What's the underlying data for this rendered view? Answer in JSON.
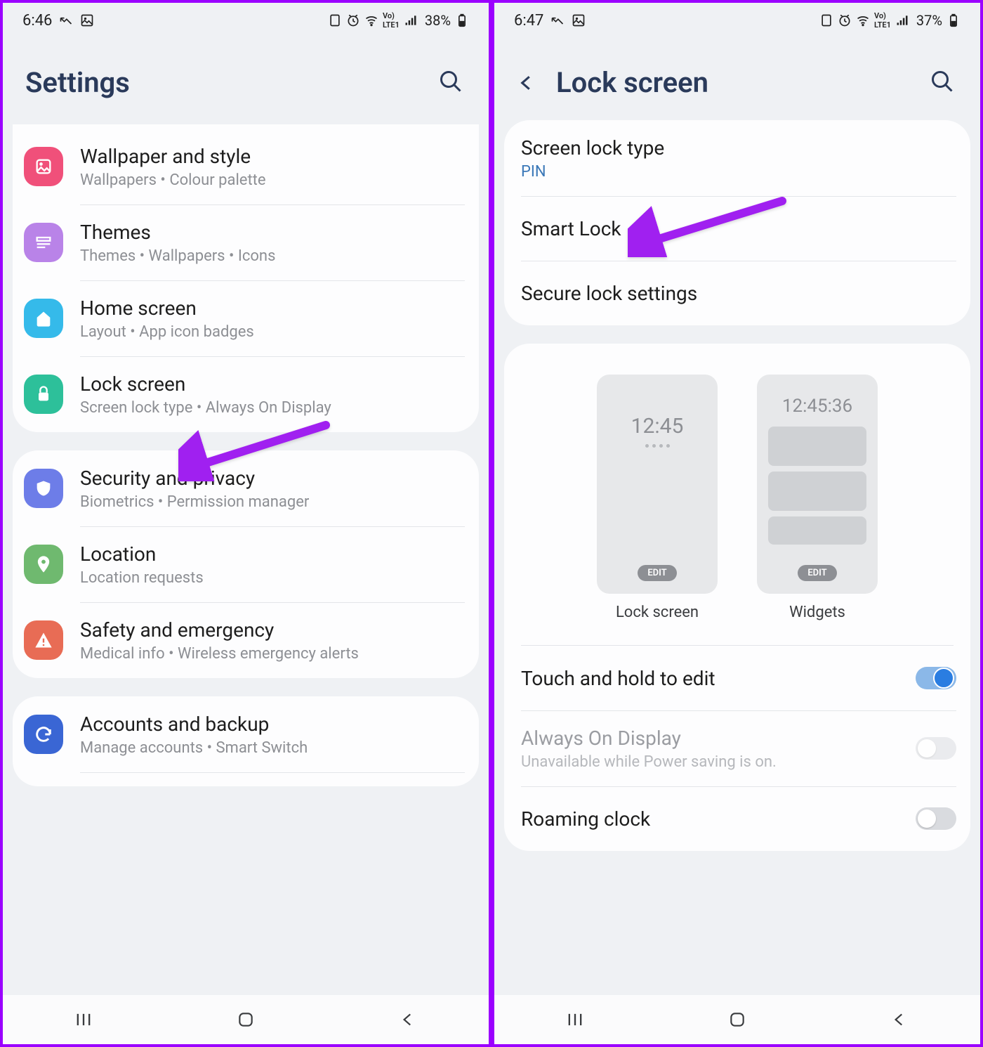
{
  "left": {
    "status": {
      "time": "6:46",
      "battery": "38%"
    },
    "header": {
      "title": "Settings"
    },
    "groups": [
      {
        "rows": [
          {
            "icon": "wallpaper",
            "color": "#f0507a",
            "title": "Wallpaper and style",
            "sub": "Wallpapers   •   Colour palette"
          },
          {
            "icon": "themes",
            "color": "#b983e8",
            "title": "Themes",
            "sub": "Themes   •   Wallpapers   •   Icons"
          },
          {
            "icon": "home",
            "color": "#35baea",
            "title": "Home screen",
            "sub": "Layout   •   App icon badges"
          },
          {
            "icon": "lock",
            "color": "#2dc09a",
            "title": "Lock screen",
            "sub": "Screen lock type   •   Always On Display"
          }
        ]
      },
      {
        "rows": [
          {
            "icon": "shield",
            "color": "#6d7de8",
            "title": "Security and privacy",
            "sub": "Biometrics   •   Permission manager"
          },
          {
            "icon": "location",
            "color": "#6fb96f",
            "title": "Location",
            "sub": "Location requests"
          },
          {
            "icon": "alert",
            "color": "#e86c55",
            "title": "Safety and emergency",
            "sub": "Medical info   •   Wireless emergency alerts"
          }
        ]
      },
      {
        "rows": [
          {
            "icon": "sync",
            "color": "#3a66d4",
            "title": "Accounts and backup",
            "sub": "Manage accounts   •   Smart Switch"
          }
        ]
      }
    ]
  },
  "right": {
    "status": {
      "time": "6:47",
      "battery": "37%"
    },
    "header": {
      "title": "Lock screen"
    },
    "group1": {
      "rows": [
        {
          "title": "Screen lock type",
          "sub": "PIN",
          "sub_accent": true
        },
        {
          "title": "Smart Lock"
        },
        {
          "title": "Secure lock settings"
        }
      ]
    },
    "previews": {
      "lock": {
        "time": "12:45",
        "edit": "EDIT",
        "label": "Lock screen"
      },
      "widgets": {
        "time": "12:45:36",
        "edit": "EDIT",
        "label": "Widgets"
      }
    },
    "group2": {
      "rows": [
        {
          "title": "Touch and hold to edit",
          "toggle": "on"
        },
        {
          "title": "Always On Display",
          "sub": "Unavailable while Power saving is on.",
          "toggle": "off",
          "disabled": true
        },
        {
          "title": "Roaming clock",
          "toggle": "off"
        }
      ]
    }
  }
}
